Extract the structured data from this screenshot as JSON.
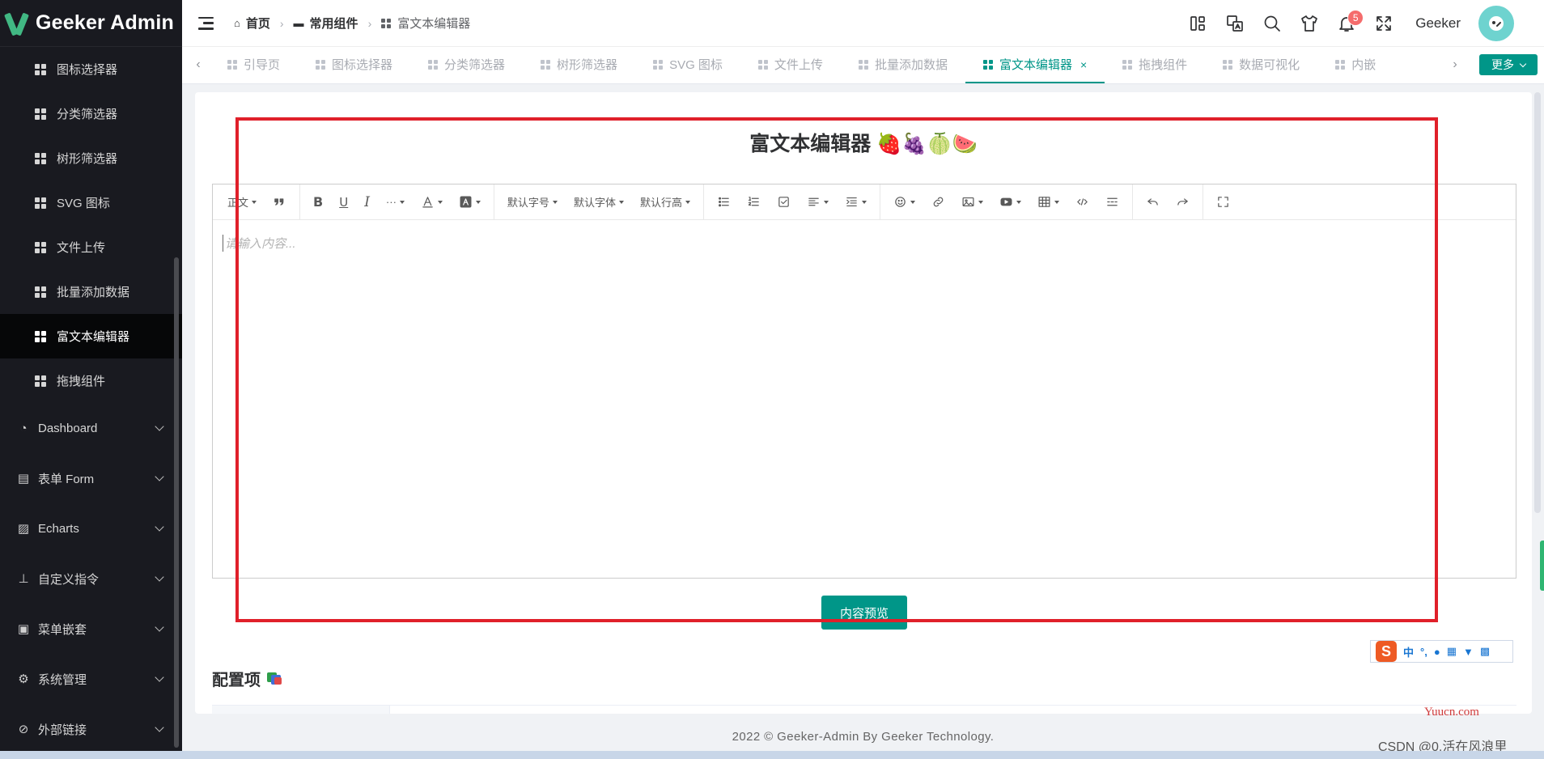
{
  "app": {
    "name": "Geeker Admin"
  },
  "sidebar": {
    "sub_items": [
      {
        "label": "图标选择器"
      },
      {
        "label": "分类筛选器"
      },
      {
        "label": "树形筛选器"
      },
      {
        "label": "SVG 图标"
      },
      {
        "label": "文件上传"
      },
      {
        "label": "批量添加数据"
      },
      {
        "label": "富文本编辑器",
        "active": true
      },
      {
        "label": "拖拽组件"
      }
    ],
    "top_items": [
      {
        "label": "Dashboard",
        "icon": "gauge-icon",
        "glyph": "◔"
      },
      {
        "label": "表单 Form",
        "icon": "form-icon",
        "glyph": "▤"
      },
      {
        "label": "Echarts",
        "icon": "chart-icon",
        "glyph": "▨"
      },
      {
        "label": "自定义指令",
        "icon": "stamp-icon",
        "glyph": "⊥"
      },
      {
        "label": "菜单嵌套",
        "icon": "clipboard-icon",
        "glyph": "▣"
      },
      {
        "label": "系统管理",
        "icon": "gear-icon",
        "glyph": "⚙"
      },
      {
        "label": "外部链接",
        "icon": "paperclip-icon",
        "glyph": "⊘"
      }
    ]
  },
  "header": {
    "breadcrumb": [
      {
        "label": "首页",
        "icon": "home-icon"
      },
      {
        "label": "常用组件",
        "icon": "briefcase-icon"
      },
      {
        "label": "富文本编辑器",
        "icon": "grid-icon"
      }
    ],
    "notification_count": "5",
    "username": "Geeker"
  },
  "tabs": {
    "items": [
      {
        "label": "引导页"
      },
      {
        "label": "图标选择器"
      },
      {
        "label": "分类筛选器"
      },
      {
        "label": "树形筛选器"
      },
      {
        "label": "SVG 图标"
      },
      {
        "label": "文件上传"
      },
      {
        "label": "批量添加数据"
      },
      {
        "label": "富文本编辑器",
        "active": true
      },
      {
        "label": "拖拽组件"
      },
      {
        "label": "数据可视化"
      },
      {
        "label": "内嵌"
      }
    ],
    "close_glyph": "×",
    "more_label": "更多"
  },
  "editor": {
    "title": "富文本编辑器 🍓🍇🍈🍉",
    "toolbar": {
      "paragraph": "正文",
      "font_size": "默认字号",
      "font_family": "默认字体",
      "line_height": "默认行高",
      "more": "···"
    },
    "placeholder": "请输入内容...",
    "preview_button": "内容预览"
  },
  "config": {
    "title": "配置项"
  },
  "ime": {
    "zh": "中"
  },
  "footer": {
    "text": "2022 © Geeker-Admin By Geeker Technology."
  },
  "watermarks": {
    "site": "Yuucn.com",
    "csdn": "CSDN @0.活在风浪里"
  },
  "colors": {
    "primary": "#009688",
    "sidebar_bg": "#191a20",
    "highlight": "#e0202a",
    "badge": "#f56c6c"
  }
}
